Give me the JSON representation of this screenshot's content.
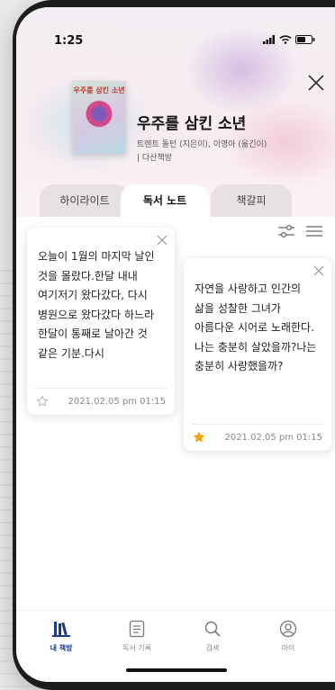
{
  "status_bar": {
    "time": "1:25",
    "signal_icon": "signal-icon",
    "wifi_icon": "wifi-icon",
    "battery_icon": "battery-icon"
  },
  "book": {
    "cover_text": "우주를 삼킨 소년",
    "title": "우주를 삼킨 소년",
    "authors": "트렌트 돌턴 (지은이), 이영아 (옮긴이)",
    "publisher": "| 다산책방"
  },
  "tabs": [
    {
      "label": "하이라이트"
    },
    {
      "label": "독서 노트"
    },
    {
      "label": "책갈피"
    }
  ],
  "notes": [
    {
      "text": "오늘이 1월의 마지막 날인 것을 몰랐다.한달 내내 여기저기 왔다갔다, 다시 병원으로 왔다갔다 하느라 한달이 통째로 날아간 것 같은 기분.다시",
      "date": "2021.02.05 pm 01:15",
      "starred": false
    },
    {
      "text": "자연을 사랑하고 인간의 삶을 성찰한 그녀가 아름다운 시어로 노래한다.나는 충분히 살았을까?나는 충분히 사랑했을까?",
      "date": "2021.02.05 pm 01:15",
      "starred": true
    }
  ],
  "nav": [
    {
      "label": "내 책방",
      "icon": "library-icon",
      "active": true
    },
    {
      "label": "독서 기록",
      "icon": "note-icon",
      "active": false
    },
    {
      "label": "검색",
      "icon": "search-icon",
      "active": false
    },
    {
      "label": "마이",
      "icon": "profile-icon",
      "active": false
    }
  ],
  "colors": {
    "accent": "#1e3a8a",
    "star": "#f5a300",
    "tab_inactive": "#e7e1e4"
  }
}
